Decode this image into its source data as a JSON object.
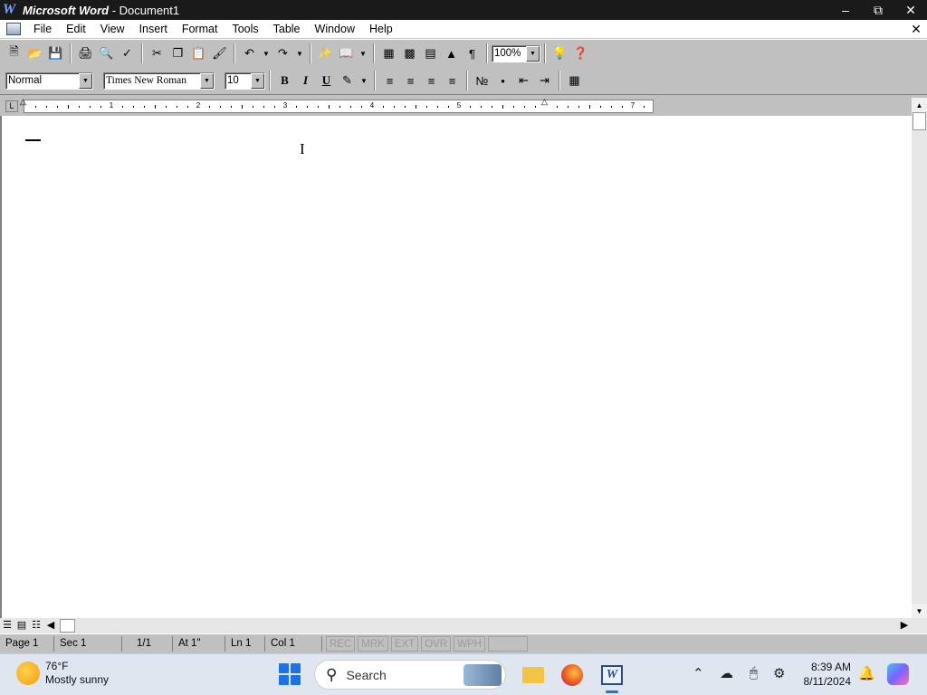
{
  "window": {
    "app_name": "Microsoft Word",
    "title_suffix": " - Document1",
    "app_icon_letter": "W"
  },
  "menu": [
    "File",
    "Edit",
    "View",
    "Insert",
    "Format",
    "Tools",
    "Table",
    "Window",
    "Help"
  ],
  "formatting": {
    "style": "Normal",
    "font": "Times New Roman",
    "size": "10",
    "zoom": "100%",
    "bold_label": "B",
    "italic_label": "I",
    "underline_label": "U"
  },
  "ruler": {
    "numbers": [
      "1",
      "2",
      "3",
      "4",
      "5",
      "7"
    ]
  },
  "status": {
    "page": "Page 1",
    "sec": "Sec 1",
    "pages": "1/1",
    "at": "At 1\"",
    "ln": "Ln 1",
    "col": "Col 1",
    "modes": [
      "REC",
      "MRK",
      "EXT",
      "OVR",
      "WPH"
    ]
  },
  "taskbar": {
    "temperature": "76°F",
    "condition": "Mostly sunny",
    "search_placeholder": "Search",
    "time": "8:39 AM",
    "date": "8/11/2024"
  }
}
